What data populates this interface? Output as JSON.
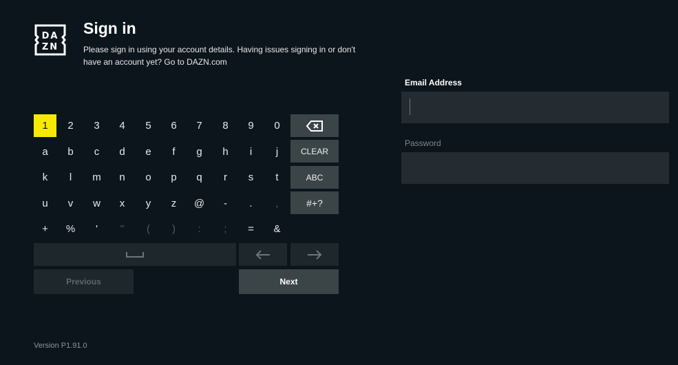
{
  "header": {
    "logo_text": [
      "DA",
      "ZN"
    ],
    "title": "Sign in",
    "subtitle": "Please sign in using your account details. Having issues signing in or don't have an account yet? Go to DAZN.com"
  },
  "keyboard": {
    "rows": [
      [
        {
          "k": "1",
          "focus": true
        },
        {
          "k": "2"
        },
        {
          "k": "3"
        },
        {
          "k": "4"
        },
        {
          "k": "5"
        },
        {
          "k": "6"
        },
        {
          "k": "7"
        },
        {
          "k": "8"
        },
        {
          "k": "9"
        },
        {
          "k": "0"
        }
      ],
      [
        {
          "k": "a"
        },
        {
          "k": "b"
        },
        {
          "k": "c"
        },
        {
          "k": "d"
        },
        {
          "k": "e"
        },
        {
          "k": "f"
        },
        {
          "k": "g"
        },
        {
          "k": "h"
        },
        {
          "k": "i"
        },
        {
          "k": "j"
        }
      ],
      [
        {
          "k": "k"
        },
        {
          "k": "l"
        },
        {
          "k": "m"
        },
        {
          "k": "n"
        },
        {
          "k": "o"
        },
        {
          "k": "p"
        },
        {
          "k": "q"
        },
        {
          "k": "r"
        },
        {
          "k": "s"
        },
        {
          "k": "t"
        }
      ],
      [
        {
          "k": "u"
        },
        {
          "k": "v"
        },
        {
          "k": "w"
        },
        {
          "k": "x"
        },
        {
          "k": "y"
        },
        {
          "k": "z"
        },
        {
          "k": "@"
        },
        {
          "k": "-"
        },
        {
          "k": "."
        },
        {
          "k": ",",
          "dim": true
        }
      ],
      [
        {
          "k": "+"
        },
        {
          "k": "%"
        },
        {
          "k": "'"
        },
        {
          "k": "\"",
          "dim": true
        },
        {
          "k": "(",
          "dim": true
        },
        {
          "k": ")",
          "dim": true
        },
        {
          "k": ":",
          "dim": true
        },
        {
          "k": ";",
          "dim": true
        },
        {
          "k": "="
        },
        {
          "k": "&"
        }
      ]
    ],
    "side_keys": {
      "backspace_icon": "backspace-icon",
      "clear": "CLEAR",
      "abc": "ABC",
      "symbols": "#+?"
    },
    "space_icon": "space-icon",
    "left_icon": "arrow-left-icon",
    "right_icon": "arrow-right-icon",
    "previous": "Previous",
    "next": "Next"
  },
  "form": {
    "email_label": "Email Address",
    "email_value": "",
    "password_label": "Password",
    "password_value": ""
  },
  "colors": {
    "focus": "#f7ea00",
    "background": "#0c151c"
  },
  "footer": {
    "version": "Version P1.91.0"
  }
}
